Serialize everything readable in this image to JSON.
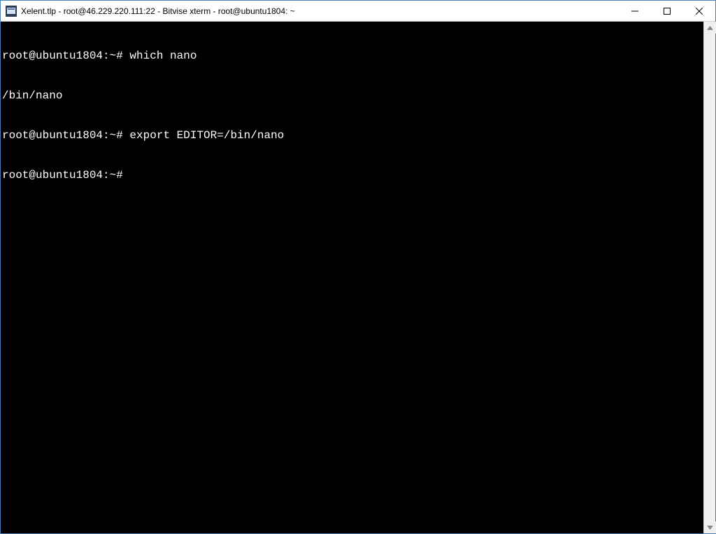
{
  "window": {
    "title": "Xelent.tlp - root@46.229.220.111:22 - Bitvise xterm - root@ubuntu1804: ~"
  },
  "terminal": {
    "lines": [
      "root@ubuntu1804:~# which nano",
      "/bin/nano",
      "root@ubuntu1804:~# export EDITOR=/bin/nano",
      "root@ubuntu1804:~#"
    ]
  }
}
